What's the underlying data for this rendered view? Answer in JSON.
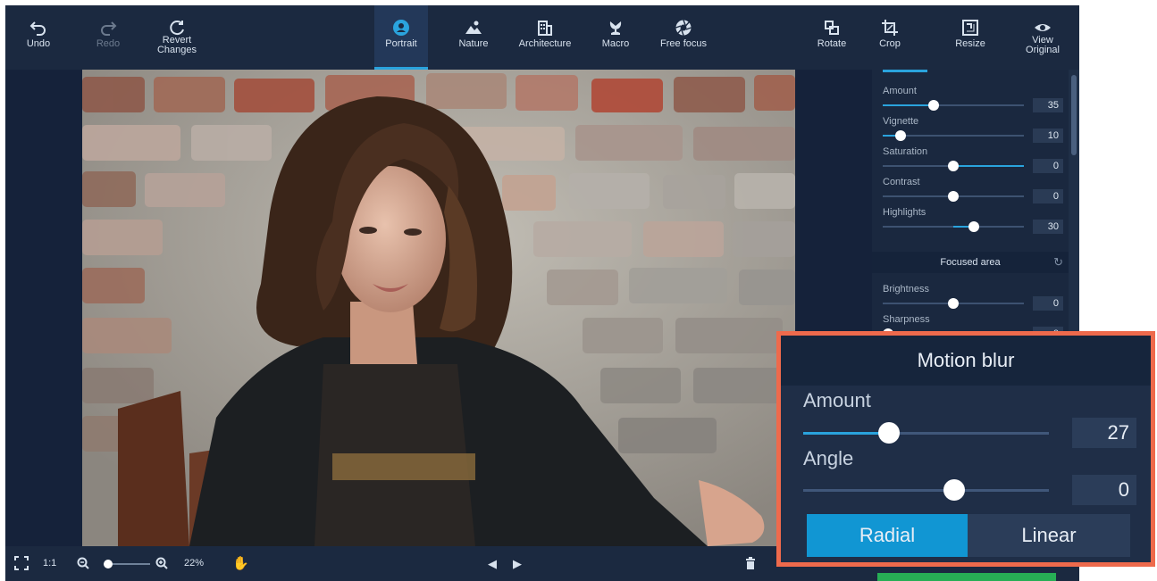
{
  "toolbar": {
    "undo": "Undo",
    "redo": "Redo",
    "revert_line1": "Revert",
    "revert_line2": "Changes",
    "tabs": [
      {
        "label": "Portrait",
        "active": true
      },
      {
        "label": "Nature"
      },
      {
        "label": "Architecture"
      },
      {
        "label": "Macro"
      },
      {
        "label": "Free focus"
      }
    ],
    "rotate": "Rotate",
    "crop": "Crop",
    "resize": "Resize",
    "view_line1": "View",
    "view_line2": "Original"
  },
  "panel": {
    "sliders": [
      {
        "label": "Amount",
        "value": "35",
        "level": 0.35
      },
      {
        "label": "Vignette",
        "value": "10",
        "level": 0.1
      },
      {
        "label": "Saturation",
        "value": "0",
        "level": 0.5,
        "filled_right": true
      },
      {
        "label": "Contrast",
        "value": "0",
        "level": 0.5
      },
      {
        "label": "Highlights",
        "value": "30",
        "level": 0.65
      }
    ],
    "focused_area": "Focused area",
    "focused_sliders": [
      {
        "label": "Brightness",
        "value": "0",
        "level": 0.5
      },
      {
        "label": "Sharpness",
        "value": "0",
        "level": 0.05
      }
    ]
  },
  "bottombar": {
    "actual_size": "1:1",
    "zoom": "22%"
  },
  "motion_blur": {
    "title": "Motion blur",
    "amount_label": "Amount",
    "amount_value": "27",
    "amount_level": 0.27,
    "angle_label": "Angle",
    "angle_value": "0",
    "angle_level": 0.5,
    "modes": [
      "Radial",
      "Linear"
    ],
    "selected_mode": "Radial"
  },
  "colors": {
    "accent": "#2aa3dd",
    "callout_border": "#ee6a4c",
    "save_green": "#27ae55"
  }
}
